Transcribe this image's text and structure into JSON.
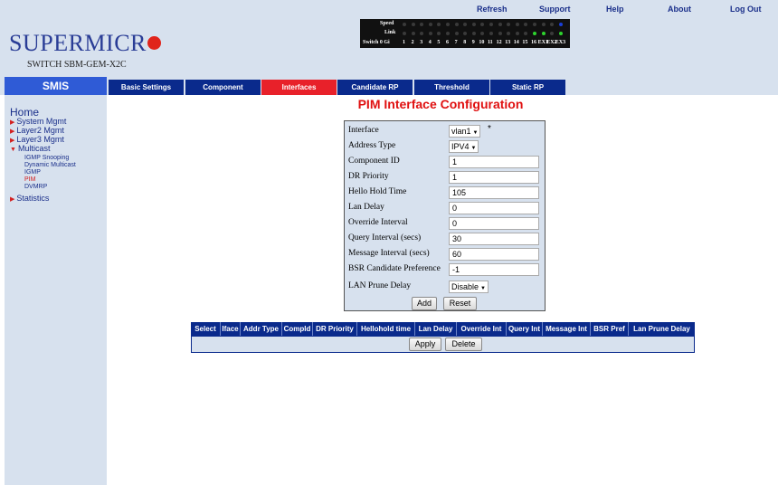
{
  "header": {
    "top_links": [
      "Refresh",
      "Support",
      "Help",
      "About",
      "Log Out"
    ],
    "logo_text": "SUPERMICR",
    "switch_name": "SWITCH SBM-GEM-X2C",
    "port_panel": {
      "speed_label": "Speed",
      "link_label": "Link",
      "switch_label": "Switch 0 Gi",
      "port_numbers": [
        "1",
        "2",
        "3",
        "4",
        "5",
        "6",
        "7",
        "8",
        "9",
        "10",
        "11",
        "12",
        "13",
        "14",
        "15",
        "16",
        "EX1",
        "EX2",
        "EX3"
      ]
    }
  },
  "nav": {
    "smis": "SMIS",
    "tabs": [
      "Basic Settings",
      "Component",
      "Interfaces",
      "Candidate RP",
      "Threshold",
      "Static RP"
    ],
    "active_tab": "Interfaces"
  },
  "sidebar": {
    "home": "Home",
    "items": [
      "System Mgmt",
      "Layer2 Mgmt",
      "Layer3 Mgmt",
      "Multicast",
      "Statistics"
    ],
    "multicast_sub": [
      "IGMP Snooping",
      "Dynamic Multicast",
      "IGMP",
      "PIM",
      "DVMRP"
    ],
    "active_sub": "PIM"
  },
  "form": {
    "title": "PIM Interface Configuration",
    "interface_label": "Interface",
    "interface_value": "vlan1",
    "required_marker": "*",
    "address_type_label": "Address Type",
    "address_type_value": "IPV4",
    "component_id_label": "Component ID",
    "component_id_value": "1",
    "dr_priority_label": "DR Priority",
    "dr_priority_value": "1",
    "hello_hold_time_label": "Hello Hold Time",
    "hello_hold_time_value": "105",
    "lan_delay_label": "Lan Delay",
    "lan_delay_value": "0",
    "override_interval_label": "Override Interval",
    "override_interval_value": "0",
    "query_interval_label": "Query Interval (secs)",
    "query_interval_value": "30",
    "message_interval_label": "Message Interval (secs)",
    "message_interval_value": "60",
    "bsr_pref_label": "BSR Candidate Preference",
    "bsr_pref_value": "-1",
    "lan_prune_delay_label": "LAN Prune Delay",
    "lan_prune_delay_value": "Disable",
    "add_label": "Add",
    "reset_label": "Reset"
  },
  "table": {
    "columns": [
      "Select",
      "Iface",
      "Addr Type",
      "CompId",
      "DR Priority",
      "Hellohold time",
      "Lan Delay",
      "Override Int",
      "Query Int",
      "Message Int",
      "BSR Pref",
      "Lan Prune Delay"
    ],
    "apply_label": "Apply",
    "delete_label": "Delete"
  }
}
